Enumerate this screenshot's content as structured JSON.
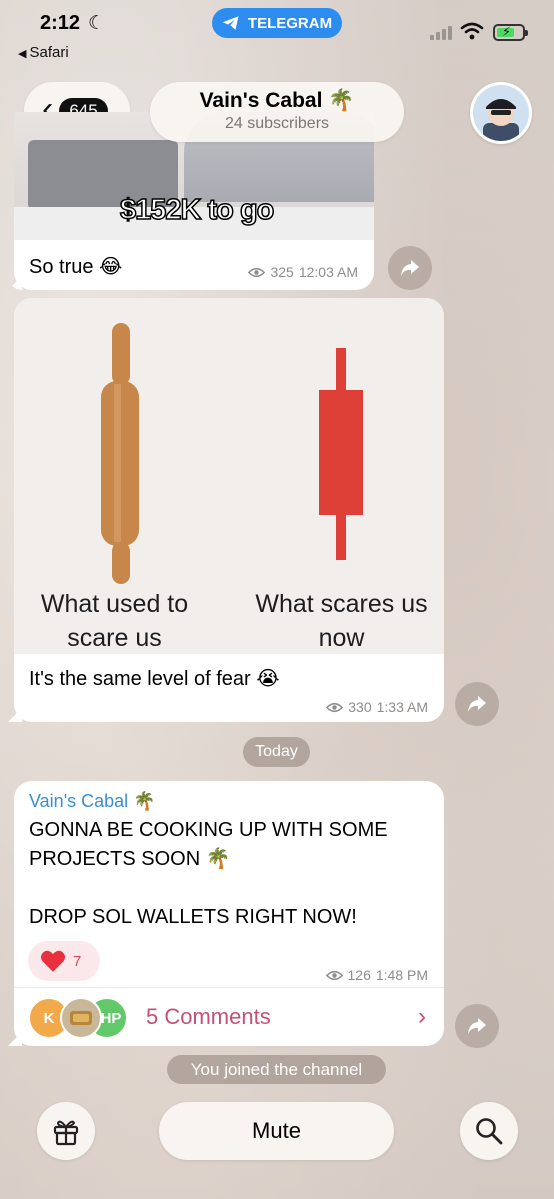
{
  "status_bar": {
    "time": "2:12",
    "back_app": "Safari",
    "telegram_pill": "TELEGRAM"
  },
  "header": {
    "back_count": "645",
    "channel_title": "Vain's Cabal 🌴",
    "subscribers": "24 subscribers"
  },
  "messages": [
    {
      "image_caption": "$152K to go",
      "text": "So true 😂",
      "views": "325",
      "time": "12:03 AM"
    },
    {
      "image_label_left": "What used to scare us",
      "image_label_right": "What scares us now",
      "text": "It's the same level of fear 😭",
      "views": "330",
      "time": "1:33 AM"
    }
  ],
  "date_separator": "Today",
  "post": {
    "author": "Vain's Cabal 🌴",
    "line1": "GONNA BE COOKING UP WITH SOME",
    "line2": "PROJECTS SOON 🌴",
    "line3": "DROP SOL WALLETS RIGHT NOW!",
    "reaction_count": "7",
    "views": "126",
    "time": "1:48 PM",
    "comment_avatars": [
      "K",
      "HP"
    ],
    "comments_label": "5 Comments"
  },
  "service_message": "You joined the channel",
  "bottom_bar": {
    "mute_label": "Mute"
  },
  "colors": {
    "accent_blue": "#2d8cf0",
    "author_blue": "#3a8fd1",
    "comments_pink": "#c4507a",
    "candle_red": "#de4037"
  }
}
